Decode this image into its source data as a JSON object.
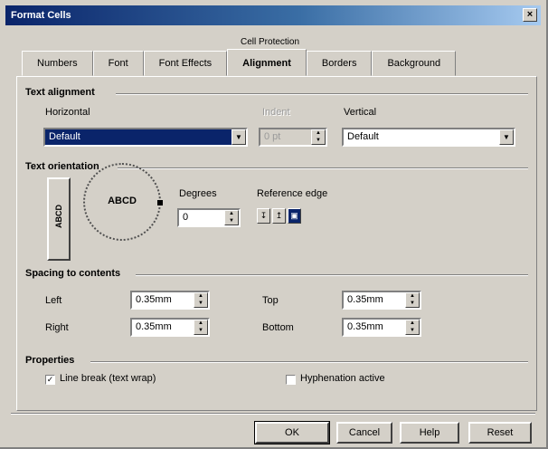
{
  "window": {
    "title": "Format Cells",
    "close_glyph": "×"
  },
  "tabs_group_label": "Cell Protection",
  "tabs": [
    {
      "label": "Numbers",
      "active": false
    },
    {
      "label": "Font",
      "active": false
    },
    {
      "label": "Font Effects",
      "active": false
    },
    {
      "label": "Alignment",
      "active": true
    },
    {
      "label": "Borders",
      "active": false
    },
    {
      "label": "Background",
      "active": false
    }
  ],
  "text_alignment": {
    "section": "Text alignment",
    "horizontal_label": "Horizontal",
    "horizontal_value": "Default",
    "indent_label": "Indent",
    "indent_value": "0 pt",
    "vertical_label": "Vertical",
    "vertical_value": "Default"
  },
  "text_orientation": {
    "section": "Text orientation",
    "vertical_stacked": "ABCD",
    "dial_text": "ABCD",
    "degrees_label": "Degrees",
    "degrees_value": "0",
    "reference_edge_label": "Reference edge"
  },
  "spacing": {
    "section": "Spacing to contents",
    "left_label": "Left",
    "left_value": "0.35mm",
    "right_label": "Right",
    "right_value": "0.35mm",
    "top_label": "Top",
    "top_value": "0.35mm",
    "bottom_label": "Bottom",
    "bottom_value": "0.35mm"
  },
  "properties": {
    "section": "Properties",
    "wrap_label": "Line break (text wrap)",
    "wrap_checked": true,
    "hyphenation_label": "Hyphenation active",
    "hyphenation_checked": false,
    "check_glyph": "✓"
  },
  "buttons": {
    "ok": "OK",
    "cancel": "Cancel",
    "help": "Help",
    "reset": "Reset"
  }
}
